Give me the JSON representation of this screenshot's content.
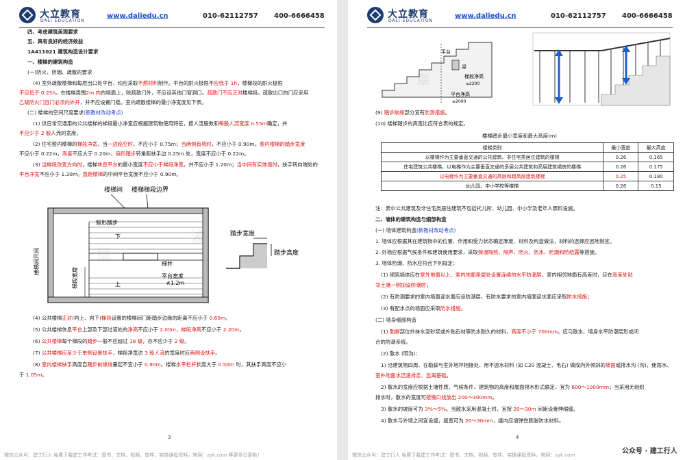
{
  "header": {
    "brand": "大立教育",
    "brand_en": "DALI EDUCATION",
    "url": "www.daliedu.cn",
    "phone1": "010-62112757",
    "phone2": "400-6666458"
  },
  "left": {
    "l1": "四、考虑建筑美观要求",
    "l2": "五、具有良好的经济效益",
    "l3": "1A411021 建筑构造设计要求",
    "l4": "一、楼梯的建筑构造",
    "l5": "(一)防火、防烟、疏散的要求",
    "p1a": "(4) 室外疏散楼梯和每层出口处平台，均应采取",
    "p1b": "不燃材料",
    "p1c": "制作。平台的耐火极限不",
    "p1d": "应低于 1h",
    "p1e": "，楼梯段的耐火极限",
    "p1f": "不应低于 0.25h",
    "p1g": "。在楼梯周围",
    "p1h": "2m 内",
    "p1i": "的墙面上，除疏散门外，不应设其他门窗洞口。",
    "p1j": "疏散门不应正对",
    "p1k": "楼梯段。疏散出口的门应采用",
    "p1l": "乙级防火门且门必须向外开",
    "p1m": "，并不应设置门槛。室内疏散楼梯的最小净宽度见下表。",
    "s2": "(二) 楼梯的空间尺度要求",
    "s2b": "(新教材改动考点)",
    "q1a": "(1) 供日常交通用的公共楼梯的梯段最小净宽应根据建筑物使用特征，按人流股数和",
    "q1b": "每股人流宽度 0.55m",
    "q1c": "确定，并",
    "q1d": "不应少于 2 股",
    "q1e": "人流的宽度。",
    "q2a": "(2) 住宅套内楼梯的",
    "q2b": "梯段净宽",
    "q2c": "，当",
    "q2d": "一边临空时",
    "q2e": "，不应小于 0.75m；",
    "q2f": "当两侧有墙时",
    "q2g": "，不应小于 0.90m。",
    "q2h": "套内楼梯的踏步宽度",
    "q2i": "不应小于 0.22m，",
    "q2j": "高度",
    "q2k": "不应大于 0.20m，",
    "q2l": "扇形踏步",
    "q2m": "转角距扶手边 0.25m 处，宽度不应小于 0.22m。",
    "q3a": "(3) ",
    "q3b": "当梯段改变方向时",
    "q3c": "，楼梯",
    "q3d": "休息平台",
    "q3e": "的最小宽度",
    "q3f": "不应小于梯段净宽",
    "q3g": "，并不应小于 1.20m；",
    "q3h": "当中间有实体墙时",
    "q3i": "，扶手转向端处的",
    "q3j": "平台净宽",
    "q3k": "不应小于 1.30m。",
    "q3l": "直跑楼梯",
    "q3m": "的中间平台宽度不应小于 0.90m。",
    "d_stairwell": "楼梯间",
    "d_boundary": "楼梯梯段边界",
    "d_rect_step": "矩形踏步",
    "d_down": "下",
    "d_up": "上",
    "d_well": "梯井",
    "d_opening": "楼梯间开间",
    "d_flight_w": "梯段宽度",
    "d_landing": "平台宽度",
    "d_landing2": "≮1.2m",
    "d_tread": "踏步宽度",
    "d_riser": "踏步高度",
    "d_wm1": "章",
    "d_wm2": "波",
    "q4a": "(4) 公共楼梯",
    "q4b": "正对",
    "q4c": "(向上、向下)",
    "q4d": "梯段",
    "q4e": "设置的楼梯间门距踏步边缘的距离不应小于 ",
    "q4f": "0.60m",
    "q4g": "。",
    "q5a": "(5) 公共楼梯休息",
    "q5b": "平台",
    "q5c": "上部及下部过道处的",
    "q5d": "净高",
    "q5e": "不应小于 ",
    "q5f": "2.00m",
    "q5g": "，",
    "q5h": "梯段净高",
    "q5i": "不应小于 ",
    "q5j": "2.20m",
    "q5k": "。",
    "q6a": "(6) ",
    "q6b": "公共楼梯",
    "q6c": "每个梯段的",
    "q6d": "踏步",
    "q6e": "一般不应超过 ",
    "q6f": "18 级",
    "q6g": "，亦不应少于 ",
    "q6h": "2 级",
    "q6i": "。",
    "q7a": "(7) ",
    "q7b": "公共楼梯应至少于单侧设置扶手",
    "q7c": "，梯段净宽达 ",
    "q7d": "3 股人流",
    "q7e": "的宽度时应",
    "q7f": "两侧设扶手",
    "q7g": "。",
    "q8a": "(8) ",
    "q8b": "室内楼梯扶手",
    "q8c": "高度自",
    "q8d": "踏步前缘线",
    "q8e": "量起不宜小于 ",
    "q8f": "0.90m",
    "q8g": "。楼梯",
    "q8h": "水平栏杆",
    "q8i": "长度大于 ",
    "q8j": "0.50m",
    "q8k": " 时，其扶手高度不应小",
    "q8l": "于 ",
    "q8m": "1.05m",
    "q8n": "。",
    "page_num": "3"
  },
  "right": {
    "f_platform": "平台",
    "f_beam": "梁",
    "f_step_clear": "梯段净高",
    "f_step_clear_v": "≥2200",
    "f_plat_clear": "平台净高",
    "f_plat_clear_v": "≥2000",
    "f_wm": "章",
    "n9a": "(9) ",
    "n9b": "踏步前缘",
    "n9c": "部分宜有",
    "n9d": "防滑措施",
    "n9e": "。",
    "n10": "(10) 楼梯踏步的高宽比应符合表的规定。",
    "table_title": "楼梯踏步最小宽度和最大高度(m)",
    "table_headers": [
      "楼梯类别",
      "最小宽度",
      "最大高度"
    ],
    "table_rows": [
      {
        "cat": "以楼梯作为主要垂直交通的公共建筑、非住宅类居住建筑的楼梯",
        "w": "0.26",
        "h": "0.165"
      },
      {
        "cat": "住宅建筑公共楼梯、以电梯作为主要垂直交通的多层公共建筑和高层建筑裙房的楼梯",
        "w": "0.26",
        "h": "0.175"
      },
      {
        "cat": "以电梯作为主要垂直交通的高层和超高层建筑楼梯",
        "w": "0.25",
        "h": "0.180"
      },
      {
        "cat": "幼儿园、中小学校等楼梯",
        "w": "0.26",
        "h": "0.15"
      }
    ],
    "note": "注：表中公共建筑及非住宅类居住建筑不包括托儿所、幼儿园、中小学及老年人照料设施。",
    "h2": "二、墙体的建筑构造与细部构造",
    "h3a": "(一) 墙体建筑构造",
    "h3b": "(新教材改动考点)",
    "w1": "1. 墙体应根据其在建筑物中的位置、作用和受力状态确定厚度、材料及构造做法，材料的选择应因地制宜。",
    "w2a": "2. 外墙应根据气候条件和建筑使用要求，采取",
    "w2b": "保温隔热、隔声、防火、防水、防潮和防结露",
    "w2c": "等措施。",
    "w3": "3. 墙体防潮、防水应符合下列规定：",
    "w31a": "(1) 砌筑墙体应在",
    "w31b": "室外地面以上、室内地面垫层处设置连续的水平防潮层",
    "w31c": "，室内相邻地面有高差时，应在",
    "w31d": "高差处贴",
    "w31e": "邻土壤一侧加设防潮层",
    "w31f": "；",
    "w32a": "(2) 有防潮要求的室内墙面迎水面应设防潮层，有防水要求的室内墙面迎水面应采取",
    "w32b": "防水措施",
    "w32c": "；",
    "w33a": "(3) 有配水点的墙面应采取",
    "w33b": "防水措施",
    "w33c": "。",
    "h3c": "(二) 墙身细部构造",
    "d1a": "(1) ",
    "d1b": "勒脚",
    "d1c": "部位外抹水泥砂浆或外贴石材等防水耐久的材料，",
    "d1d": "高度不小于 700mm",
    "d1e": "。应与散水、墙身水平防潮层形成闭",
    "d1f": "合的防潮系统。",
    "d2": "(2) 散水 (明沟)：",
    "d21a": "1) 沿建筑物四周、在勒脚与室外地坪相接处、用不透水材料 (如 C20 混凝土、毛石) 做成向外倾斜的",
    "d21b": "坡面",
    "d21c": "或排水沟 (沟)，使雨水、",
    "d21d": "室外地面水",
    "d21e": "迅速排走、远离基础",
    "d21f": "。",
    "d22a": "2) 散水的宽度应根据土壤性质、气候条件、建筑物的高度和屋面排水形式确定，宜为 ",
    "d22b": "600～1000mm",
    "d22c": "；当采用无组织",
    "d22d": "排水时，散水的宽度可",
    "d22e": "按檐口线放出 200～300mm",
    "d22f": "。",
    "d23a": "3) 散水的坡度可为 ",
    "d23b": "3%～5%",
    "d23c": "。当散水采用混凝土时，宜按 ",
    "d23d": "20～30m",
    "d23e": " 间距设置伸缩缝。",
    "d24a": "4) 散水与外墙之间宜设缝，缝宽可为 ",
    "d24b": "20～30mm",
    "d24c": "，缝内应填弹性膨胀防水材料。",
    "page_num": "4"
  },
  "footer": {
    "left": "微信公众号：建工行人 免费下载建工作考试：图书、文档、视频、软件、实操课程资料，官网：zyk.com 等更多日更新！",
    "right": "微信公众号：建工行人 免费下载建工作考试：图书、文档、视频、软件、实操课程资料，官网：zyk.com",
    "wm": "公众号 · 建工行人"
  },
  "colors": {
    "red": "#e01010",
    "blue": "#1a3fd0",
    "brand": "#1e3a6e"
  }
}
